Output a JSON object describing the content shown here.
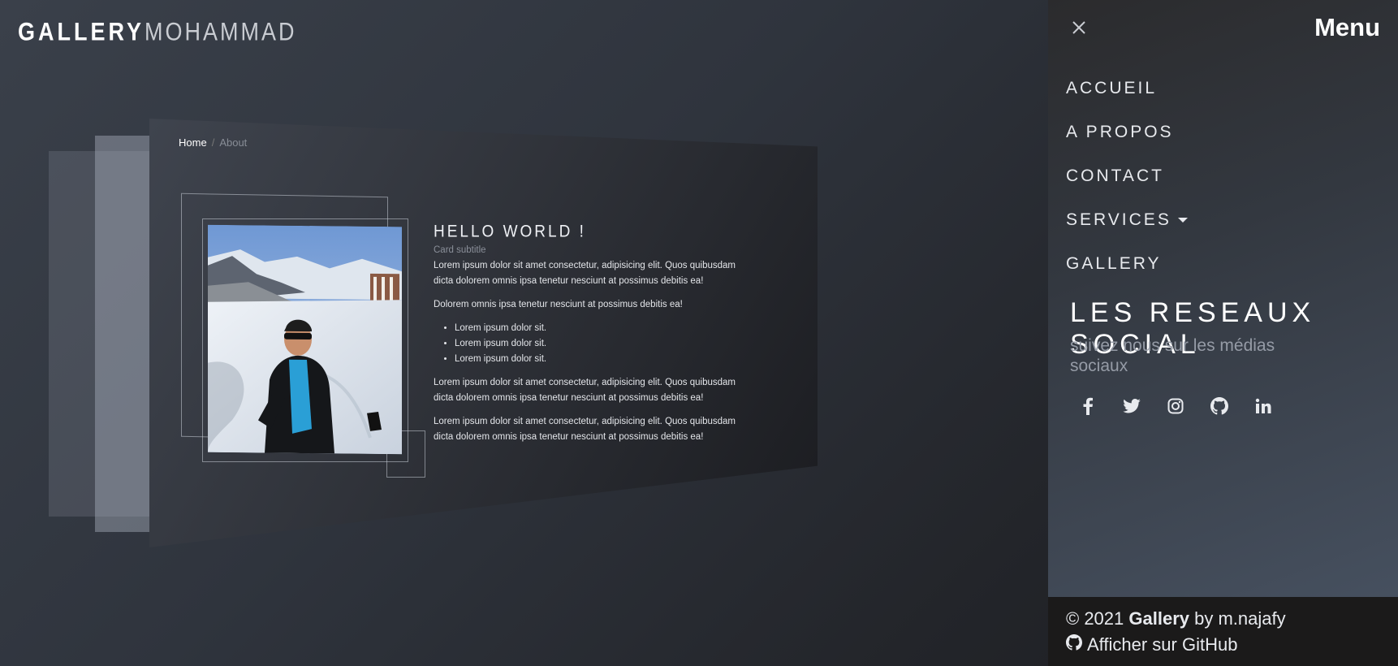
{
  "brand": {
    "part1": "GALLERY",
    "part2": "MOHAMMAD"
  },
  "breadcrumb": {
    "home": "Home",
    "separator": "/",
    "current": "About"
  },
  "card": {
    "title": "HELLO WORLD !",
    "subtitle": "Card subtitle",
    "para1": "Lorem ipsum dolor sit amet consectetur, adipisicing elit. Quos quibusdam dicta dolorem omnis ipsa tenetur nesciunt at possimus debitis ea!",
    "para2": "Dolorem omnis ipsa tenetur nesciunt at possimus debitis ea!",
    "list": [
      "Lorem ipsum dolor sit.",
      "Lorem ipsum dolor sit.",
      "Lorem ipsum dolor sit."
    ],
    "para3": "Lorem ipsum dolor sit amet consectetur, adipisicing elit. Quos quibusdam dicta dolorem omnis ipsa tenetur nesciunt at possimus debitis ea!",
    "para4": "Lorem ipsum dolor sit amet consectetur, adipisicing elit. Quos quibusdam dicta dolorem omnis ipsa tenetur nesciunt at possimus debitis ea!"
  },
  "menu": {
    "close_icon": "close-icon",
    "title": "Menu",
    "items": [
      "ACCUEIL",
      "A PROPOS",
      "CONTACT",
      "SERVICES",
      "GALLERY"
    ],
    "social_title": "LES RESEAUX SOCIAL",
    "social_sub": "suivez nous sur les médias sociaux",
    "social_icons": [
      "facebook-icon",
      "twitter-icon",
      "instagram-icon",
      "github-icon",
      "linkedin-icon"
    ]
  },
  "footer": {
    "copyright": "© 2021",
    "app": "Gallery",
    "by": "by m.najafy",
    "github_link": "Afficher sur GitHub"
  },
  "colors": {
    "panel_bg": "#46505f",
    "footer_bg": "#1b1a1a",
    "muted": "#959ba6"
  }
}
